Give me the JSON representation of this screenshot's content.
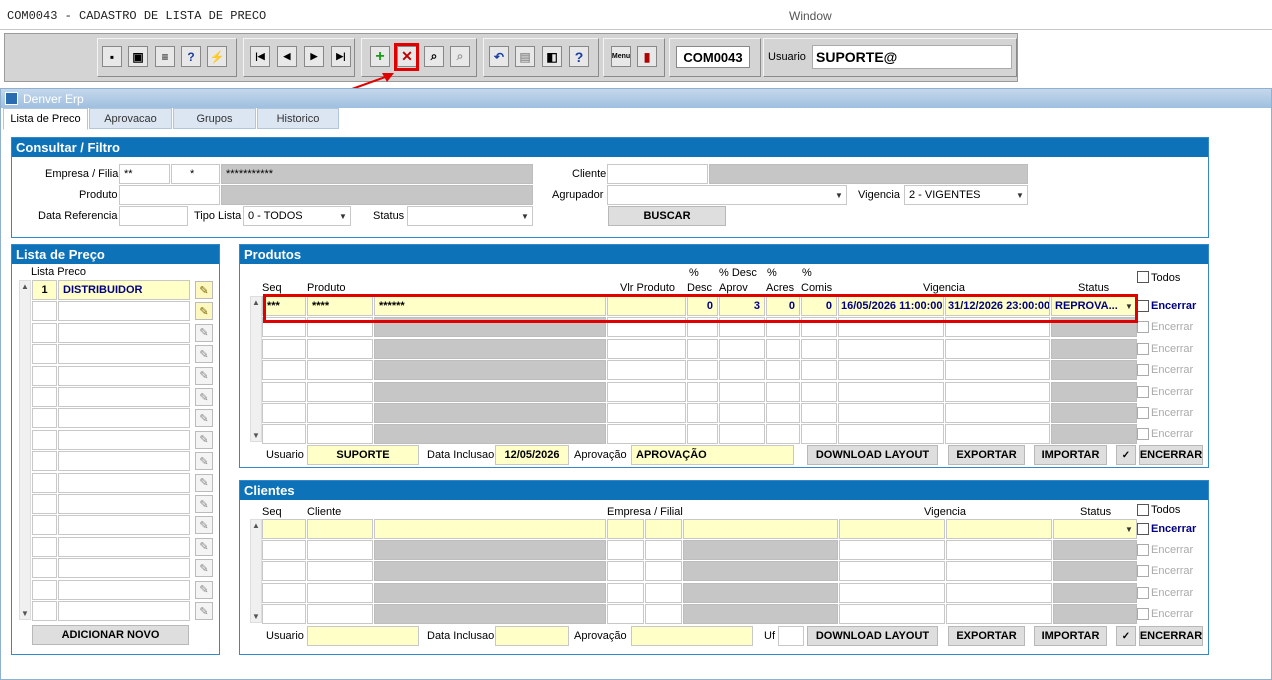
{
  "app": {
    "title": "COM0043 - CADASTRO DE LISTA DE PRECO",
    "window_label": "Window",
    "form_code": "COM0043",
    "user_label": "Usuario",
    "user_value": "SUPORTE@",
    "frame_title": "Denver Erp"
  },
  "toolbar": {
    "icons": [
      "save-icon",
      "screen-icon",
      "print-icon",
      "help-query-icon",
      "clear-icon",
      "first-record-icon",
      "prev-record-icon",
      "next-record-icon",
      "last-record-icon",
      "insert-record-icon",
      "delete-record-icon",
      "query-icon",
      "disabled-query-icon",
      "undo-icon",
      "paste-icon",
      "display-icon",
      "help-icon",
      "menu-icon",
      "exit-icon"
    ],
    "menu_label": "Menu"
  },
  "tabs": [
    {
      "label": "Lista de Preco"
    },
    {
      "label": "Aprovacao"
    },
    {
      "label": "Grupos"
    },
    {
      "label": "Historico"
    }
  ],
  "filter": {
    "title": "Consultar / Filtro",
    "empresa_label": "Empresa / Filial",
    "empresa": "**",
    "filial": "*",
    "empresa_nome": "***********",
    "cliente_label": "Cliente",
    "produto_label": "Produto",
    "agrupador_label": "Agrupador",
    "vigencia_label": "Vigencia",
    "vigencia_value": "2 - VIGENTES",
    "data_ref_label": "Data Referencia",
    "tipo_lista_label": "Tipo Lista",
    "tipo_lista_value": "0 - TODOS",
    "status_label": "Status",
    "buscar": "BUSCAR"
  },
  "lista": {
    "title": "Lista de Preço",
    "col_label": "Lista Preco",
    "rows": [
      {
        "num": "1",
        "name": "DISTRIBUIDOR"
      }
    ],
    "add_button": "ADICIONAR NOVO"
  },
  "produtos": {
    "title": "Produtos",
    "headers": {
      "seq": "Seq",
      "produto": "Produto",
      "vlr": "Vlr Produto",
      "desc_pct": "%",
      "desc": "Desc",
      "descaprov_pct": "% Desc",
      "descaprov": "Aprov",
      "acres_pct": "%",
      "acres": "Acres",
      "comis_pct": "%",
      "comis": "Comis",
      "vigencia": "Vigencia",
      "status": "Status",
      "todos": "Todos"
    },
    "row": {
      "seq": "***",
      "produto": "****",
      "descricao": "******",
      "desc": "0",
      "descaprov": "3",
      "acres": "0",
      "comis": "0",
      "inicio": "16/05/2026 11:00:00",
      "fim": "31/12/2026 23:00:00",
      "status": "REPROVA...",
      "encerrar": "Encerrar"
    },
    "encerrar": "Encerrar",
    "usuario_label": "Usuario",
    "usuario": "SUPORTE",
    "data_label": "Data Inclusao",
    "data": "12/05/2026",
    "aprov_label": "Aprovação",
    "aprov": "APROVAÇÃO",
    "download": "DOWNLOAD LAYOUT",
    "exportar": "EXPORTAR",
    "importar": "IMPORTAR",
    "encerrar_btn": "ENCERRAR"
  },
  "clientes": {
    "title": "Clientes",
    "headers": {
      "seq": "Seq",
      "cliente": "Cliente",
      "empresa": "Empresa / Filial",
      "vigencia": "Vigencia",
      "status": "Status",
      "todos": "Todos"
    },
    "encerrar": "Encerrar",
    "usuario_label": "Usuario",
    "data_label": "Data Inclusao",
    "aprov_label": "Aprovação",
    "uf_label": "Uf",
    "download": "DOWNLOAD LAYOUT",
    "exportar": "EXPORTAR",
    "importar": "IMPORTAR",
    "encerrar_btn": "ENCERRAR"
  }
}
